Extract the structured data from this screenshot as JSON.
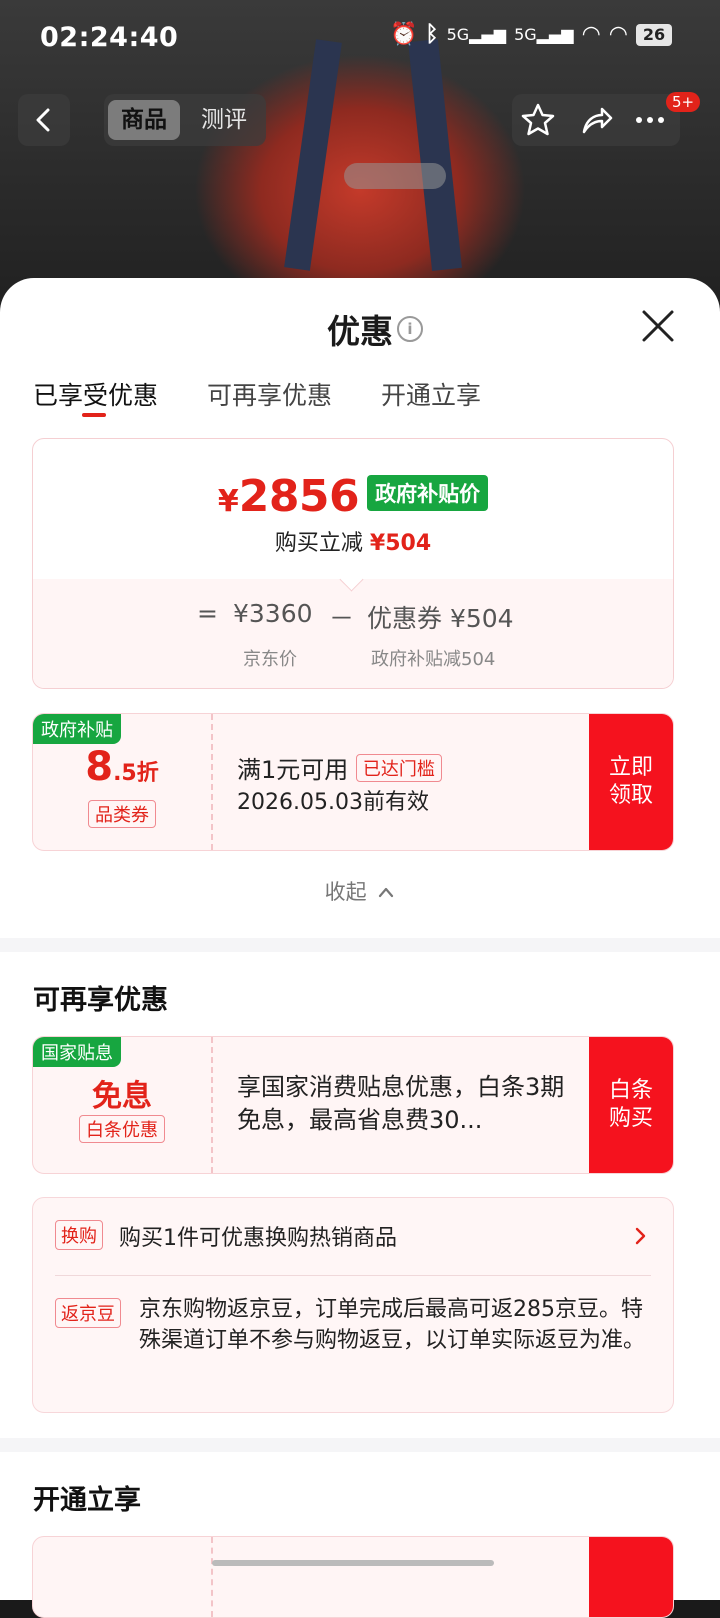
{
  "status_bar": {
    "time": "02:24:40",
    "battery": "26",
    "icons": [
      "alarm-icon",
      "bluetooth-icon",
      "5g-signal-icon",
      "5g-signal-icon",
      "wifi-icon",
      "wifi-icon",
      "battery-icon"
    ]
  },
  "top_nav": {
    "tabs": [
      "商品",
      "测评"
    ],
    "badge": "5+"
  },
  "sheet": {
    "title": "优惠",
    "tabs": [
      "已享受优惠",
      "可再享优惠",
      "开通立享"
    ]
  },
  "price_summary": {
    "yen": "¥",
    "final_price": "2856",
    "gov_tag": "政府补贴价",
    "reduce_label": "购买立减",
    "reduce_amount": "¥504",
    "equals": "=",
    "jd_price": "¥3360",
    "minus": "－",
    "coupon_label": "优惠券 ¥504",
    "jd_price_label": "京东价",
    "coupon_sub_label": "政府补贴减504"
  },
  "coupon_gov": {
    "tag": "政府补贴",
    "discount_main": "8",
    "discount_suffix": ".5折",
    "category": "品类券",
    "condition": "满1元可用",
    "threshold_tag": "已达门槛",
    "valid_until": "2026.05.03前有效",
    "button": "立即领取"
  },
  "collapse_label": "收起",
  "more_section": {
    "title": "可再享优惠",
    "coupon": {
      "tag": "国家贴息",
      "main": "免息",
      "sub": "白条优惠",
      "desc": "享国家消费贴息优惠，白条3期免息，最高省息费30...",
      "button": "白条购买"
    },
    "items": [
      {
        "tag": "换购",
        "text": "购买1件可优惠换购热销商品"
      },
      {
        "tag": "返京豆",
        "text": "京东购物返京豆，订单完成后最高可返285京豆。特殊渠道订单不参与购物返豆，以订单实际返豆为准。"
      }
    ]
  },
  "open_section": {
    "title": "开通立享"
  },
  "colors": {
    "accent_red": "#e2231a",
    "button_red": "#f5121e",
    "gov_green": "#17a640"
  }
}
